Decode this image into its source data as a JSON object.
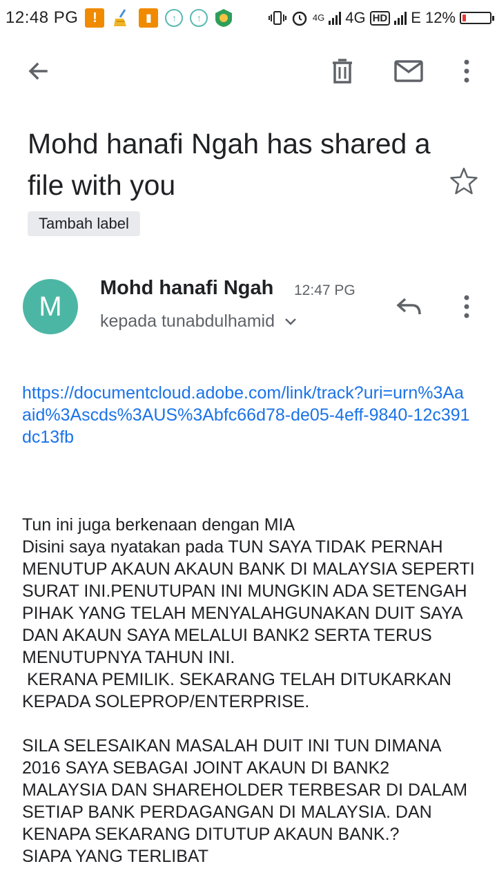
{
  "status_bar": {
    "time": "12:48 PG",
    "network_4g_small": "4G",
    "network_4g": "4G",
    "hd": "HD",
    "network_e": "E",
    "battery": "12%",
    "battery_level": 0.12
  },
  "toolbar": {
    "back_icon": "arrow-left",
    "delete_icon": "trash",
    "mail_icon": "envelope",
    "more_icon": "vertical-dots"
  },
  "email": {
    "subject": "Mohd hanafi Ngah has shared a file with you",
    "label_chip": "Tambah label",
    "avatar_letter": "M",
    "avatar_color": "#4cb6a4",
    "sender_name": "Mohd hanafi Ngah",
    "sent_time": "12:47 PG",
    "recipient": "kepada tunabdulhamid",
    "link": "https://documentcloud.adobe.com/link/track?uri=urn%3Aaaid%3Ascds%3AUS%3Abfc66d78-de05-4eff-9840-12c391dc13fb",
    "body": "Tun ini juga berkenaan dengan MIA\nDisini saya nyatakan pada TUN SAYA TIDAK PERNAH MENUTUP AKAUN AKAUN BANK DI MALAYSIA SEPERTI SURAT INI.PENUTUPAN INI MUNGKIN ADA SETENGAH PIHAK YANG TELAH MENYALAHGUNAKAN DUIT SAYA DAN AKAUN SAYA MELALUI BANK2 SERTA TERUS MENUTUPNYA TAHUN INI.\n KERANA PEMILIK. SEKARANG TELAH DITUKARKAN KEPADA SOLEPROP/ENTERPRISE.\n\nSILA SELESAIKAN MASALAH DUIT INI TUN DIMANA 2016 SAYA SEBAGAI JOINT AKAUN DI BANK2 MALAYSIA DAN SHAREHOLDER TERBESAR DI DALAM SETIAP BANK PERDAGANGAN DI MALAYSIA. DAN KENAPA SEKARANG DITUTUP AKAUN BANK.?\nSIAPA YANG TERLIBAT"
  },
  "colors": {
    "link": "#1a73e8",
    "icon": "#5f6368",
    "warning": "#f08a00",
    "battery_low": "#e53935"
  }
}
